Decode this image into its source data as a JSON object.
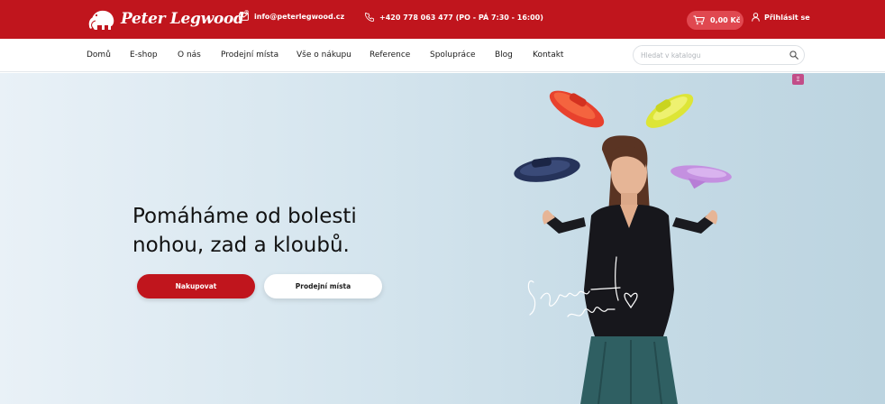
{
  "header": {
    "logo_text": "Peter Legwood",
    "logo_mark": "®",
    "email": "info@peterlegwood.cz",
    "phone": "+420 778 063 477   (PO - PÁ 7:30 - 16:00)",
    "cart_total": "0,00 Kč",
    "login_label": "Přihlásit se",
    "icons": [
      "mammoth-logo",
      "mail-icon",
      "phone-icon",
      "cart-icon",
      "user-icon"
    ],
    "colors": {
      "brand_red": "#c0151d",
      "cart_pill": "#e04850"
    }
  },
  "nav": {
    "items": [
      "Domů",
      "E-shop",
      "O nás",
      "Prodejní místa",
      "Vše o nákupu",
      "Reference",
      "Spolupráce",
      "Blog",
      "Kontakt"
    ],
    "search_placeholder": "Hledat v katalogu"
  },
  "hero": {
    "title_line1": "Pomáháme od bolesti",
    "title_line2": "nohou, zad a kloubů.",
    "primary_button": "Nakupovat",
    "secondary_button": "Prodejní místa",
    "badge": "Ξ",
    "image_description_icons": [
      "slipper-red",
      "slipper-yellow",
      "slipper-navy",
      "slipper-lilac",
      "woman-photo",
      "signature"
    ]
  }
}
